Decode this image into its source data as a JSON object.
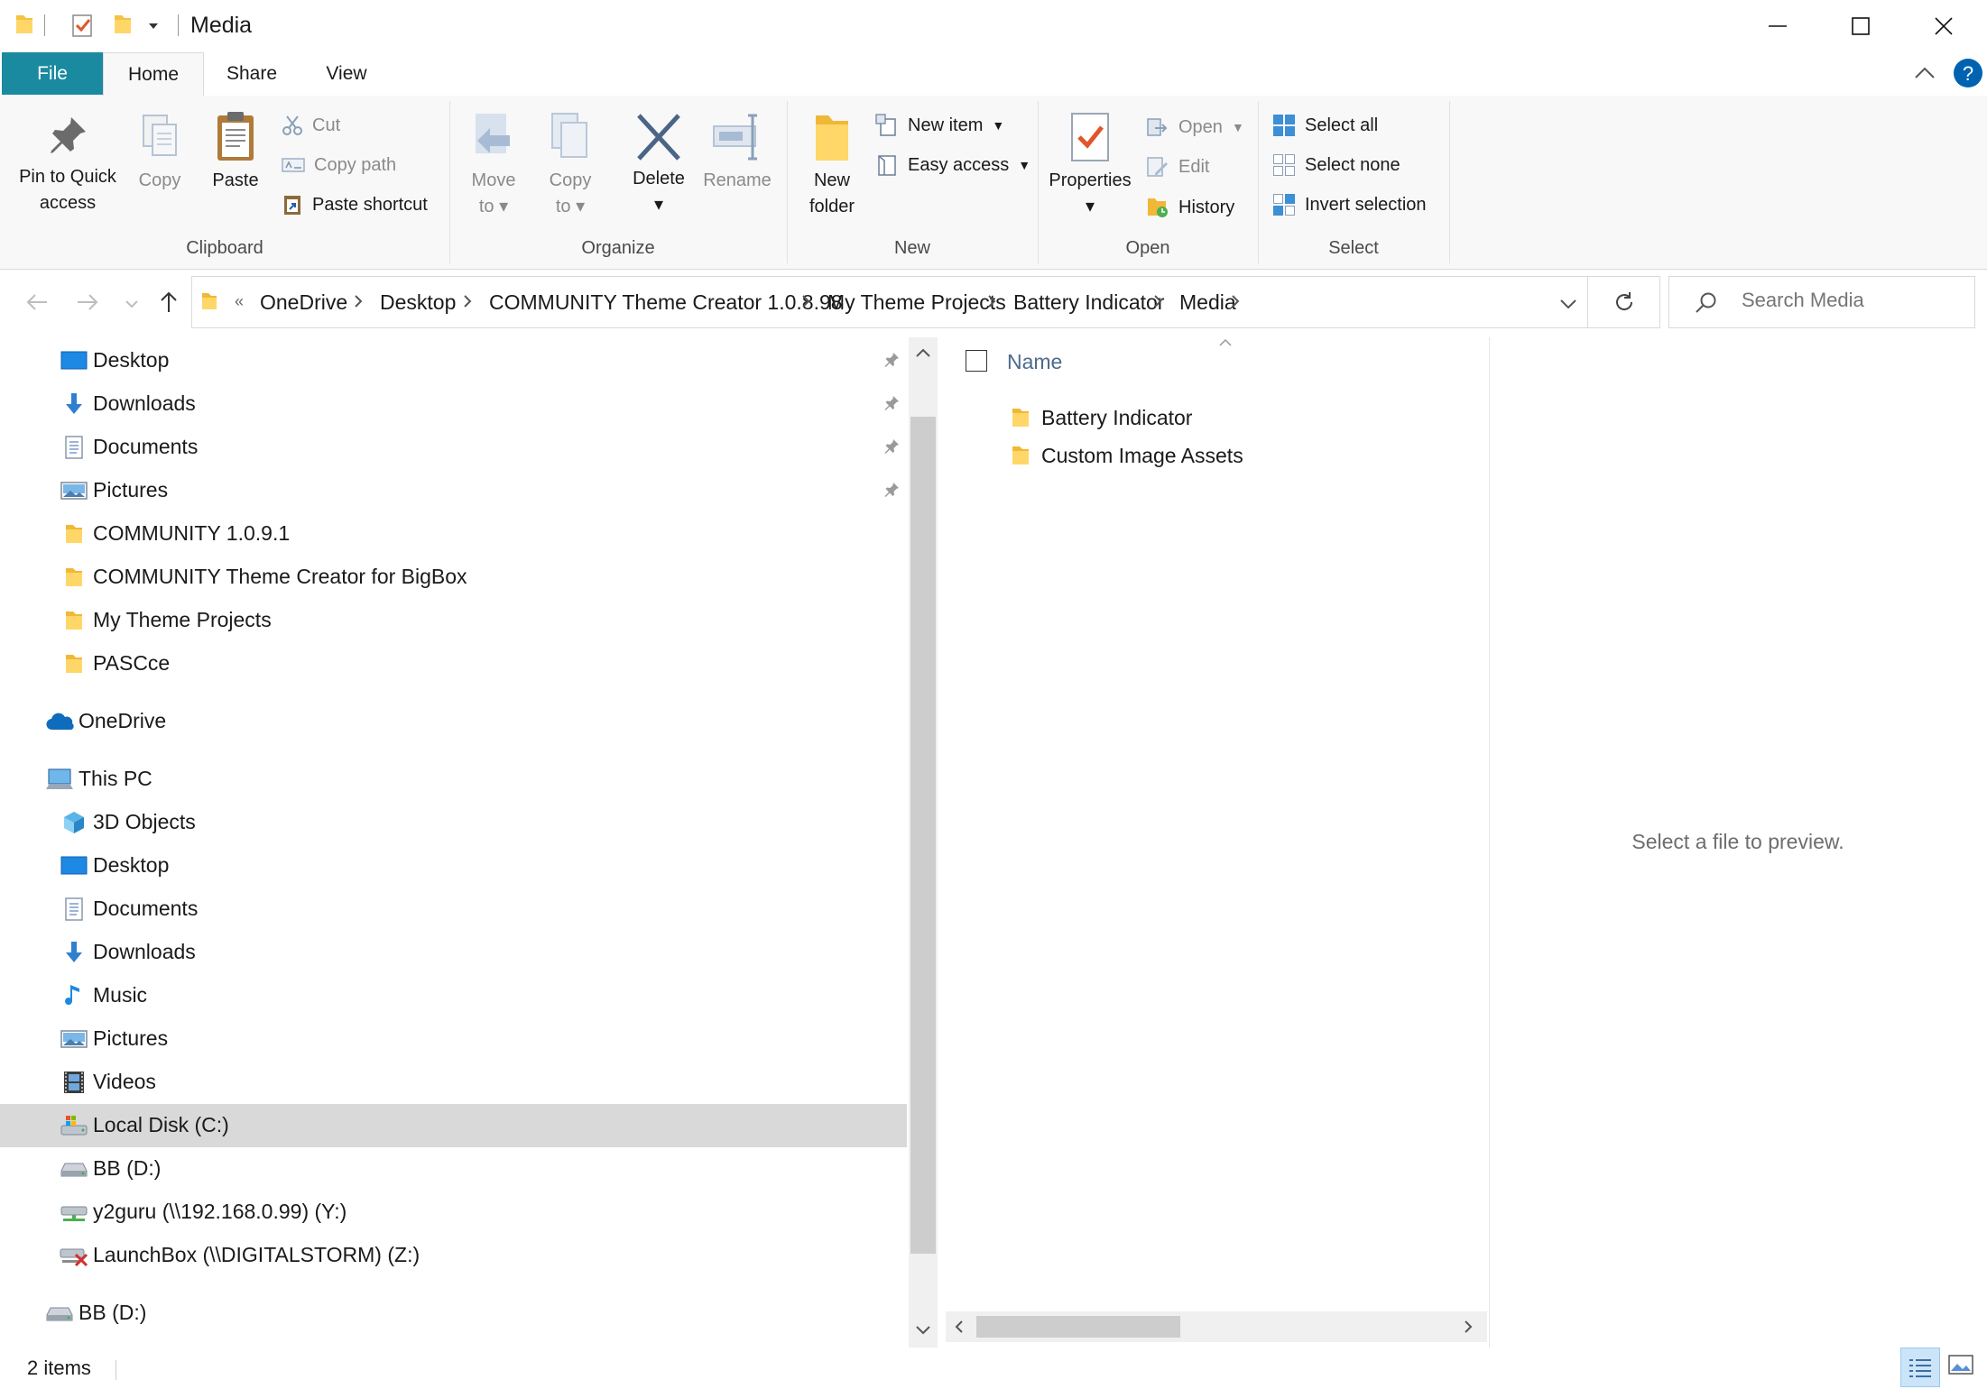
{
  "window": {
    "title": "Media",
    "minimize_icon": "minimize-icon",
    "maximize_icon": "maximize-icon",
    "close_icon": "close-icon"
  },
  "tabs": [
    {
      "label": "File"
    },
    {
      "label": "Home"
    },
    {
      "label": "Share"
    },
    {
      "label": "View"
    }
  ],
  "ribbon": {
    "clipboard": {
      "label": "Clipboard",
      "pin_line1": "Pin to Quick",
      "pin_line2": "access",
      "copy": "Copy",
      "paste": "Paste",
      "cut": "Cut",
      "copy_path": "Copy path",
      "paste_shortcut": "Paste shortcut"
    },
    "organize": {
      "label": "Organize",
      "move_line1": "Move",
      "move_line2": "to",
      "copy_line1": "Copy",
      "copy_line2": "to",
      "delete": "Delete",
      "rename": "Rename"
    },
    "new": {
      "label": "New",
      "folder_line1": "New",
      "folder_line2": "folder",
      "new_item": "New item",
      "easy_access": "Easy access"
    },
    "open": {
      "label": "Open",
      "properties": "Properties",
      "open": "Open",
      "edit": "Edit",
      "history": "History"
    },
    "select": {
      "label": "Select",
      "select_all": "Select all",
      "select_none": "Select none",
      "invert": "Invert selection"
    }
  },
  "address": {
    "overflow": "«",
    "crumbs": [
      "OneDrive",
      "Desktop",
      "COMMUNITY Theme Creator 1.0.8.98",
      "My Theme Projects",
      "Battery Indicator",
      "Media"
    ]
  },
  "search": {
    "placeholder": "Search Media"
  },
  "nav": {
    "quick_access": [
      {
        "label": "Desktop",
        "icon": "desktop-icon",
        "pinned": true
      },
      {
        "label": "Downloads",
        "icon": "downloads-icon",
        "pinned": true
      },
      {
        "label": "Documents",
        "icon": "documents-icon",
        "pinned": true
      },
      {
        "label": "Pictures",
        "icon": "pictures-icon",
        "pinned": true
      },
      {
        "label": "COMMUNITY 1.0.9.1",
        "icon": "folder-icon"
      },
      {
        "label": "COMMUNITY Theme Creator for BigBox",
        "icon": "folder-icon"
      },
      {
        "label": "My Theme Projects",
        "icon": "folder-icon"
      },
      {
        "label": "PASCce",
        "icon": "folder-icon"
      }
    ],
    "onedrive": "OneDrive",
    "this_pc": "This PC",
    "pc_items": [
      {
        "label": "3D Objects",
        "icon": "3d-objects-icon"
      },
      {
        "label": "Desktop",
        "icon": "desktop-icon"
      },
      {
        "label": "Documents",
        "icon": "documents-icon"
      },
      {
        "label": "Downloads",
        "icon": "downloads-icon"
      },
      {
        "label": "Music",
        "icon": "music-icon"
      },
      {
        "label": "Pictures",
        "icon": "pictures-icon"
      },
      {
        "label": "Videos",
        "icon": "videos-icon"
      },
      {
        "label": "Local Disk (C:)",
        "icon": "local-disk-icon",
        "selected": true
      },
      {
        "label": "BB (D:)",
        "icon": "drive-icon"
      },
      {
        "label": "y2guru (\\\\192.168.0.99) (Y:)",
        "icon": "network-drive-icon"
      },
      {
        "label": "LaunchBox (\\\\DIGITALSTORM) (Z:)",
        "icon": "disconnected-drive-icon"
      }
    ],
    "bb_drive": "BB (D:)"
  },
  "files": {
    "column_name": "Name",
    "items": [
      {
        "name": "Battery Indicator"
      },
      {
        "name": "Custom Image Assets"
      }
    ]
  },
  "preview": {
    "message": "Select a file to preview."
  },
  "status": {
    "count": "2 items"
  },
  "colors": {
    "file_tab": "#1a8aa0",
    "accent": "#0078d7",
    "selected_row": "#d9d9d9",
    "folder": "#f5c242"
  }
}
